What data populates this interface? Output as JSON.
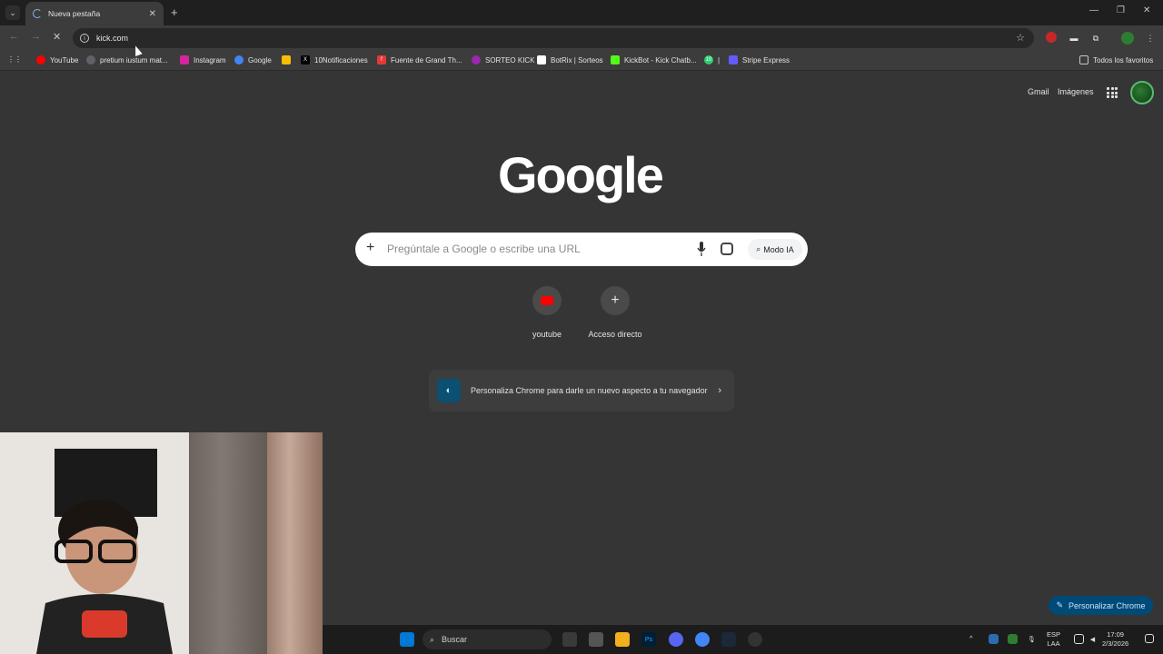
{
  "tab": {
    "title": "Nueva pestaña",
    "close": "✕",
    "new_tab": "+"
  },
  "window": {
    "minimize": "—",
    "restore": "❐",
    "close": "✕"
  },
  "omnibox": {
    "url": "kick.com"
  },
  "bookmarks": [
    {
      "label": "YouTube",
      "icon": "youtube-icon",
      "color": "#ff0000"
    },
    {
      "label": "pretium iustum mat...",
      "icon": "globe-icon",
      "color": "#5f6368"
    },
    {
      "label": "Instagram",
      "icon": "instagram-icon",
      "color": "#d6249f"
    },
    {
      "label": "Google",
      "icon": "google-icon",
      "color": "#4285f4"
    },
    {
      "label": "",
      "icon": "pinwheel-icon",
      "color": "#fbbc04"
    },
    {
      "label": "10Notificaciones",
      "icon": "x-icon",
      "color": "#000000"
    },
    {
      "label": "Fuente de Grand Th...",
      "icon": "font-icon",
      "color": "#e53935"
    },
    {
      "label": "SORTEO KICK",
      "icon": "star-icon",
      "color": "#9c27b0"
    },
    {
      "label": "BotRix | Sorteos",
      "icon": "bot-icon",
      "color": "#ffffff"
    },
    {
      "label": "KickBot - Kick Chatb...",
      "icon": "kick-icon",
      "color": "#53fc18"
    },
    {
      "label": "|",
      "icon": "ten-icon",
      "color": "#2ecc71"
    },
    {
      "label": "Stripe Express",
      "icon": "stripe-icon",
      "color": "#635bff"
    }
  ],
  "all_bookmarks": "Todos los favoritos",
  "header_links": {
    "gmail": "Gmail",
    "images": "Imágenes"
  },
  "search": {
    "placeholder": "Pregúntale a Google o escribe una URL",
    "ai_mode": "Modo IA"
  },
  "shortcuts": [
    {
      "label": "youtube",
      "icon": "youtube-icon"
    },
    {
      "label": "Acceso directo",
      "icon": "plus-icon",
      "glyph": "+"
    }
  ],
  "customize_card": {
    "text": "Personaliza Chrome para darle un nuevo aspecto a tu navegador"
  },
  "customize_button": "Personalizar Chrome",
  "taskbar": {
    "search": "Buscar",
    "lang_top": "ESP",
    "lang_bottom": "LAA",
    "time": "17:09",
    "date": "2/3/2026"
  }
}
